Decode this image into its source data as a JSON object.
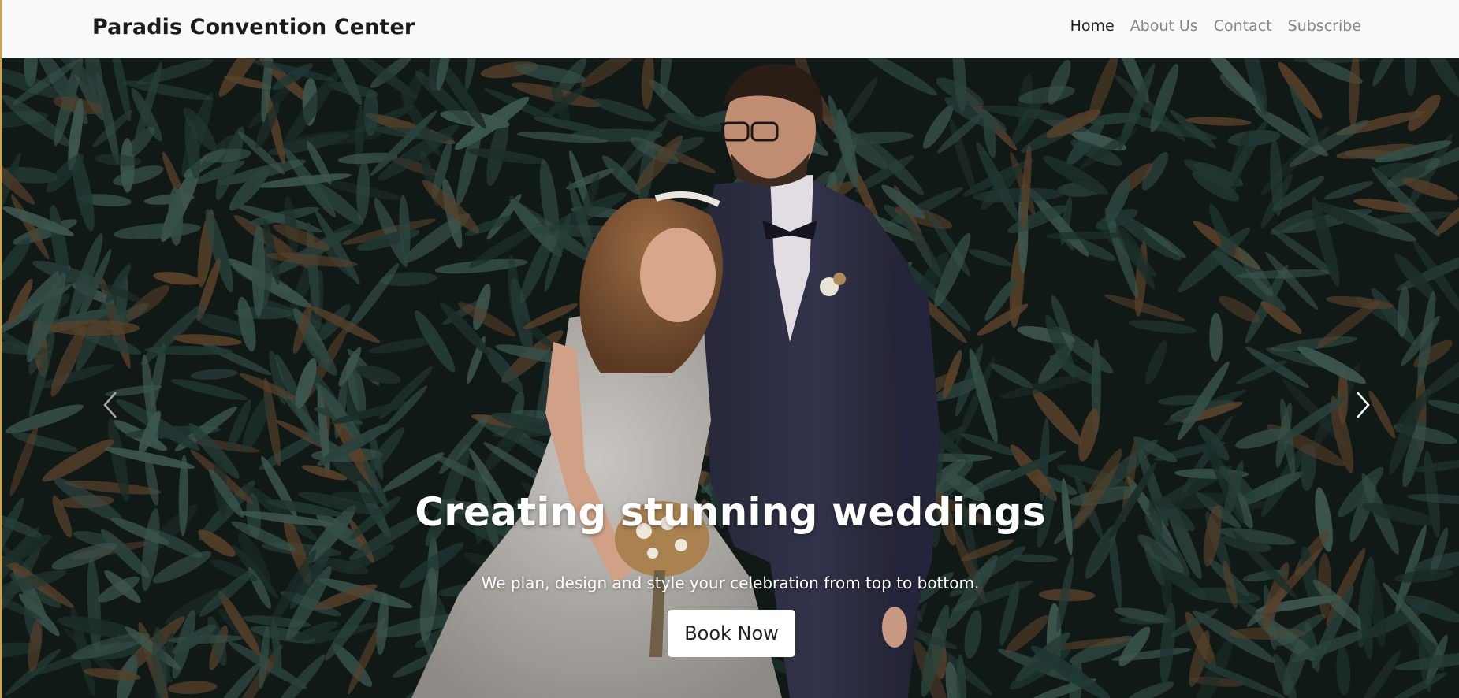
{
  "navbar": {
    "brand": "Paradis Convention Center",
    "links": [
      {
        "label": "Home",
        "active": true
      },
      {
        "label": "About Us",
        "active": false
      },
      {
        "label": "Contact",
        "active": false
      },
      {
        "label": "Subscribe",
        "active": false
      }
    ]
  },
  "hero": {
    "title": "Creating stunning weddings",
    "subtitle": "We plan, design and style your celebration from top to bottom.",
    "cta_label": "Book Now",
    "prev_icon": "chevron-left-icon",
    "next_icon": "chevron-right-icon"
  },
  "colors": {
    "navbar_bg": "#f8f9fb",
    "brand_text": "#1b1b1d",
    "nav_link": "#858585",
    "nav_link_active": "#1f1f1f",
    "foliage": "#2e4a44",
    "accent_border": "#d8a23a",
    "cta_bg": "#ffffff"
  }
}
